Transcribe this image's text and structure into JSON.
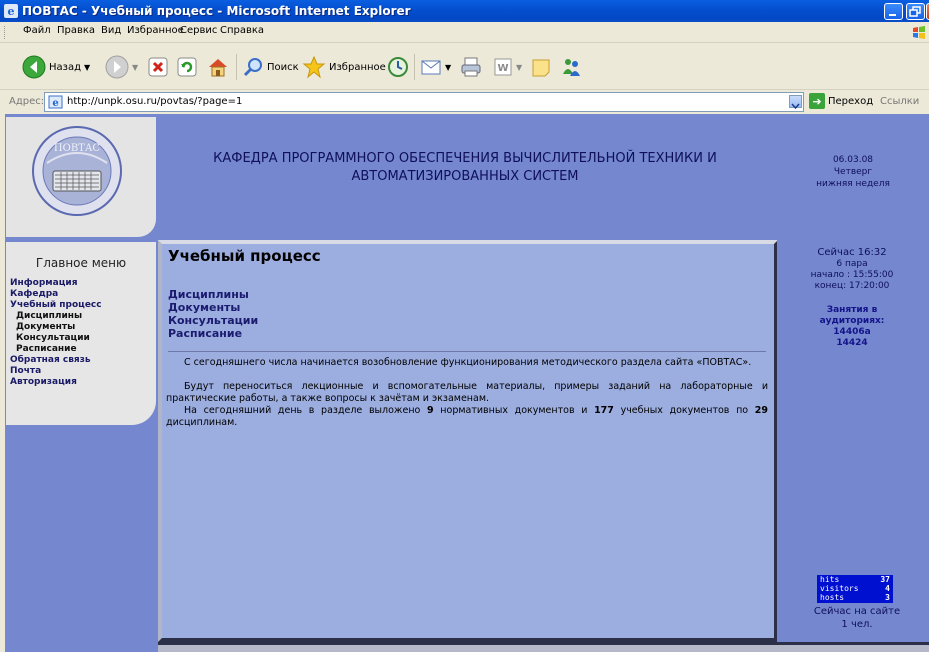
{
  "window": {
    "title": "ПОВТАС - Учебный процесс - Microsoft Internet Explorer"
  },
  "menubar": {
    "items": [
      "Файл",
      "Правка",
      "Вид",
      "Избранное",
      "Сервис",
      "Справка"
    ]
  },
  "toolbar": {
    "back_label": "Назад",
    "search_label": "Поиск",
    "favorites_label": "Избранное"
  },
  "address": {
    "label": "Адрес:",
    "url": "http://unpk.osu.ru/povtas/?page=1",
    "go_label": "Переход",
    "links_label": "Ссылки"
  },
  "site": {
    "logo_text": "ПОВТАС",
    "header_title": "КАФЕДРА ПРОГРАММНОГО ОБЕСПЕЧЕНИЯ ВЫЧИСЛИТЕЛЬНОЙ ТЕХНИКИ И АВТОМАТИЗИРОВАННЫХ СИСТЕМ",
    "date": "06.03.08",
    "weekday": "Четверг",
    "week_type": "нижняя неделя"
  },
  "menu": {
    "title": "Главное меню",
    "items": [
      {
        "label": "Информация",
        "sub": false
      },
      {
        "label": "Кафедра",
        "sub": false
      },
      {
        "label": "Учебный процесс",
        "sub": false
      },
      {
        "label": "Дисциплины",
        "sub": true
      },
      {
        "label": "Документы",
        "sub": true
      },
      {
        "label": "Консультации",
        "sub": true
      },
      {
        "label": "Расписание",
        "sub": true
      },
      {
        "label": "Обратная связь",
        "sub": false
      },
      {
        "label": "Почта",
        "sub": false
      },
      {
        "label": "Авторизация",
        "sub": false
      }
    ]
  },
  "content": {
    "title": "Учебный процесс",
    "links": [
      "Дисциплины",
      "Документы",
      "Консультации",
      "Расписание"
    ],
    "p1": "С сегодняшнего числа начинается возобновление функционирования методического раздела сайта «ПОВТАС».",
    "p2": "Будут переноситься лекционные и вспомогательные материалы, примеры заданий на лабораторные и практические работы, а также вопросы к зачётам и экзаменам.",
    "p3_a": "На сегодняшний день в разделе выложено ",
    "p3_n1": "9",
    "p3_b": " нормативных документов и ",
    "p3_n2": "177",
    "p3_c": " учебных документов по ",
    "p3_n3": "29",
    "p3_d": " дисциплинам."
  },
  "right": {
    "now": "Сейчас 16:32",
    "pair": "6 пара",
    "start": "начало : 15:55:00",
    "end": "конец: 17:20:00",
    "classes_title": "Занятия в аудиториях:",
    "rooms": [
      "14406а",
      "14424"
    ],
    "counter": {
      "hits_label": "hits",
      "hits": "37",
      "visitors_label": "visitors",
      "visitors": "4",
      "hosts_label": "hosts",
      "hosts": "3"
    },
    "online_line1": "Сейчас на сайте",
    "online_line2": "1 чел."
  },
  "colors": {
    "page_bg": "#7487cf",
    "content_bg": "#9caddf",
    "panel_bg": "#e6e6e6",
    "link": "#1b1b70"
  }
}
